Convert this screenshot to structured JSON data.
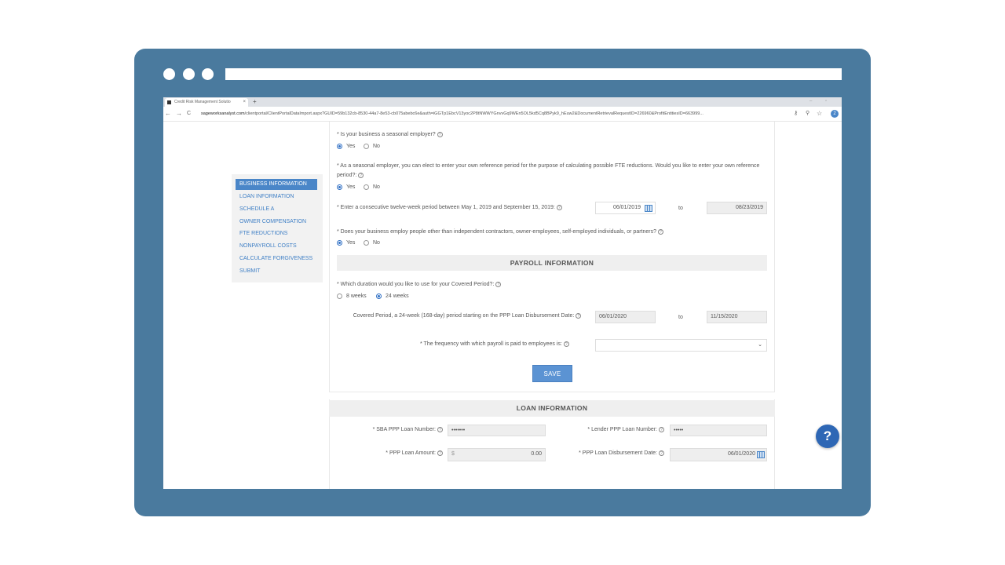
{
  "browser": {
    "tab_title": "Credit Risk Management Solutio",
    "tab_close": "×",
    "new_tab": "+",
    "url_host": "sageworksanalyst.com",
    "url_path": "/clientportal/ClientPortalDataImport.aspx?GUID=59b132cb-8530-44a7-8e53-cb075abebc6e&auth=iGGTp1EbcV13yoc2P8tNWWYGnvvGq9WEn5OL5kd5Cq8BPyk9_hEuw2&DocumentRetrievalRequestID=226960&ProfitEntitiesID=663999...",
    "profile_initial": "2",
    "back_icon": "←",
    "forward_icon": "→",
    "reload_icon": "C",
    "key_icon": "⚷",
    "zoom_icon": "⚲",
    "star_icon": "☆",
    "minimize": "–",
    "restore": "▫",
    "close": "✕"
  },
  "sidebar": {
    "items": [
      {
        "label": "BUSINESS INFORMATION",
        "active": true
      },
      {
        "label": "LOAN INFORMATION"
      },
      {
        "label": "SCHEDULE A"
      },
      {
        "label": "OWNER COMPENSATION"
      },
      {
        "label": "FTE REDUCTIONS"
      },
      {
        "label": "NONPAYROLL COSTS"
      },
      {
        "label": "CALCULATE FORGIVENESS"
      },
      {
        "label": "SUBMIT"
      }
    ]
  },
  "form": {
    "q_seasonal": "* Is your business a seasonal employer?",
    "q_reference": "* As a seasonal employer, you can elect to enter your own reference period for the purpose of calculating possible FTE reductions. Would you like to enter your own reference period?:",
    "q_twelve_week": "* Enter a consecutive twelve-week period between May 1, 2019 and September 15, 2019:",
    "ref_start": "06/01/2019",
    "ref_end": "08/23/2019",
    "to": "to",
    "q_employ_others": "* Does your business employ people other than independent contractors, owner-employees, self-employed individuals, or partners?",
    "yes": "Yes",
    "no": "No",
    "help": "?"
  },
  "payroll": {
    "header": "PAYROLL INFORMATION",
    "q_duration": "* Which duration would you like to use for your Covered Period?:",
    "opt_8": "8 weeks",
    "opt_24": "24 weeks",
    "covered_label": "Covered Period, a 24-week (168-day) period starting on the PPP Loan Disbursement Date:",
    "covered_start": "06/01/2020",
    "covered_end": "11/15/2020",
    "q_frequency": "* The frequency with which payroll is paid to employees is:",
    "frequency_value": "",
    "save_label": "SAVE"
  },
  "loan": {
    "header": "LOAN INFORMATION",
    "sba_label": "* SBA PPP Loan Number:",
    "sba_value": "•••••••",
    "lender_label": "* Lender PPP Loan Number:",
    "lender_value": "•••••",
    "amount_label": "* PPP Loan Amount:",
    "amount_currency": "$",
    "amount_value": "0.00",
    "disbursement_label": "* PPP Loan Disbursement Date:",
    "disbursement_value": "06/01/2020"
  },
  "help_button": "?"
}
